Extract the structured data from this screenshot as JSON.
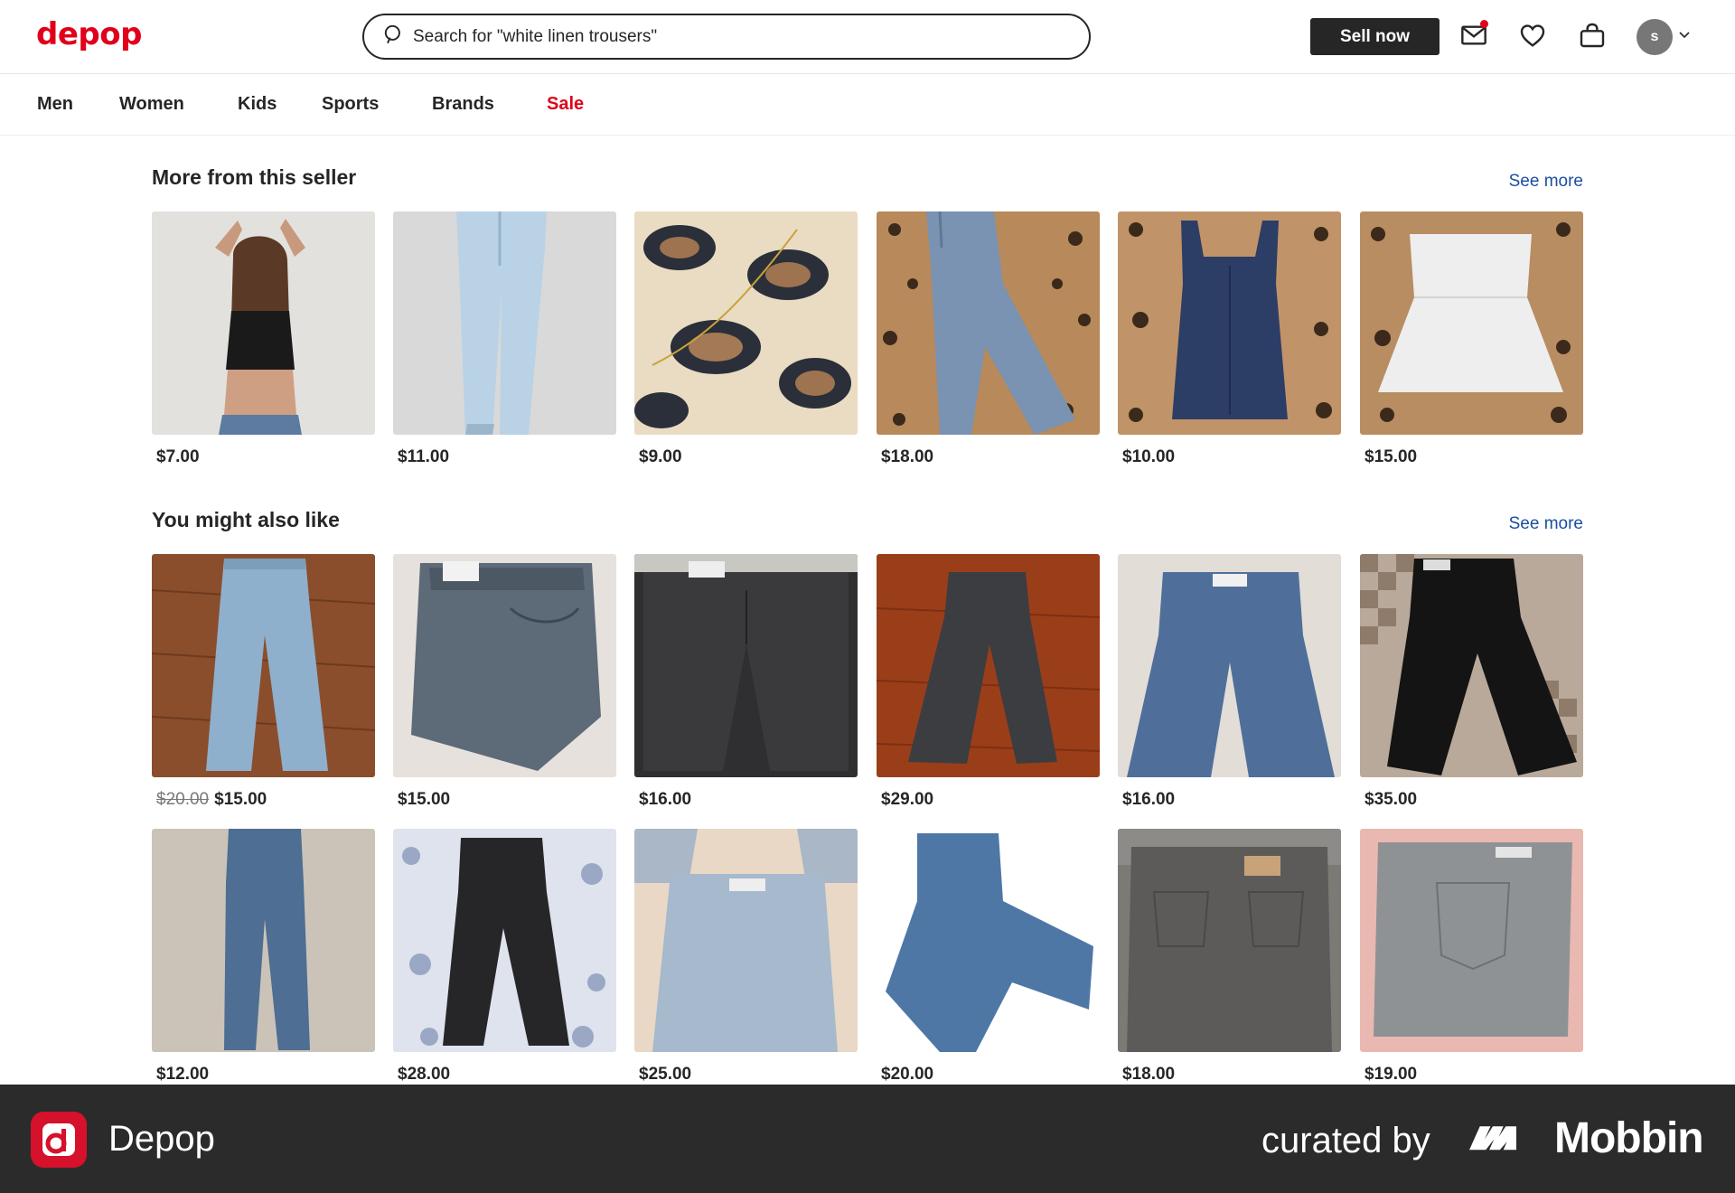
{
  "header": {
    "logo": "depop",
    "search_placeholder": "Search for \"white linen trousers\"",
    "sell_label": "Sell now",
    "avatar_initial": "s"
  },
  "nav": {
    "items": [
      "Men",
      "Women",
      "Kids",
      "Sports",
      "Brands",
      "Sale"
    ]
  },
  "seller_section": {
    "title": "More from this seller",
    "see_more": "See more",
    "items": [
      {
        "price": "$7.00",
        "desc": "model black crop top"
      },
      {
        "price": "$11.00",
        "desc": "light blue sweatpants"
      },
      {
        "price": "$9.00",
        "desc": "leopard fur with gold chain"
      },
      {
        "price": "$18.00",
        "desc": "jeans on leopard"
      },
      {
        "price": "$10.00",
        "desc": "navy tank on leopard"
      },
      {
        "price": "$15.00",
        "desc": "white tube top on leopard"
      }
    ]
  },
  "suggest_section": {
    "title": "You might also like",
    "see_more": "See more",
    "row1": [
      {
        "old_price": "$20.00",
        "price": "$15.00"
      },
      {
        "old_price": "",
        "price": "$15.00"
      },
      {
        "old_price": "",
        "price": "$16.00"
      },
      {
        "old_price": "",
        "price": "$29.00"
      },
      {
        "old_price": "",
        "price": "$16.00"
      },
      {
        "old_price": "",
        "price": "$35.00"
      }
    ],
    "row2": [
      {
        "price": "$12.00"
      },
      {
        "price": "$28.00"
      },
      {
        "price": "$25.00"
      },
      {
        "price": "$20.00"
      },
      {
        "price": "$18.00"
      },
      {
        "price": "$19.00"
      }
    ]
  },
  "footer": {
    "app_name": "Depop",
    "curated_by": "curated by",
    "brand": "Mobbin"
  },
  "colors": {
    "brand_red": "#e0001b",
    "link_blue": "#1a4fa0",
    "footer_bg": "#2b2b2b"
  }
}
